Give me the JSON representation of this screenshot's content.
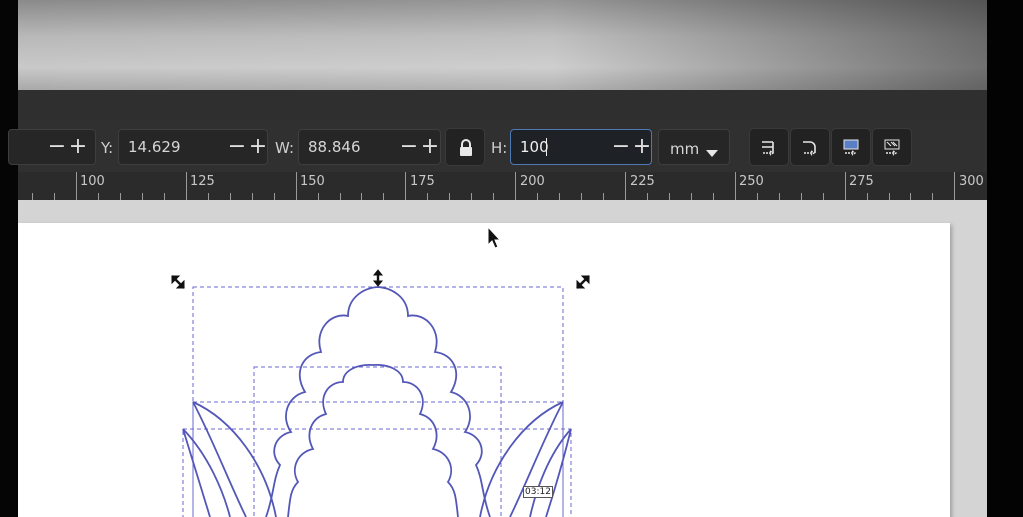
{
  "toolbar": {
    "y_label": "Y:",
    "y_value": "14.629",
    "w_label": "W:",
    "w_value": "88.846",
    "h_label": "H:",
    "h_value": "100",
    "unit": "mm",
    "minus": "−",
    "plus": "+",
    "lock_icon": "lock-icon",
    "extra_buttons": [
      "scale-stroke-icon",
      "scale-corners-icon",
      "move-gradients-icon",
      "move-patterns-icon"
    ]
  },
  "ruler": {
    "labels": [
      "100",
      "125",
      "150",
      "175",
      "200",
      "225",
      "250",
      "275",
      "300"
    ]
  },
  "canvas": {
    "time_badge": "03:12"
  },
  "colors": {
    "path_stroke": "#5357b8",
    "bbox": "#6a6ad0",
    "focus": "#4f79b3"
  }
}
